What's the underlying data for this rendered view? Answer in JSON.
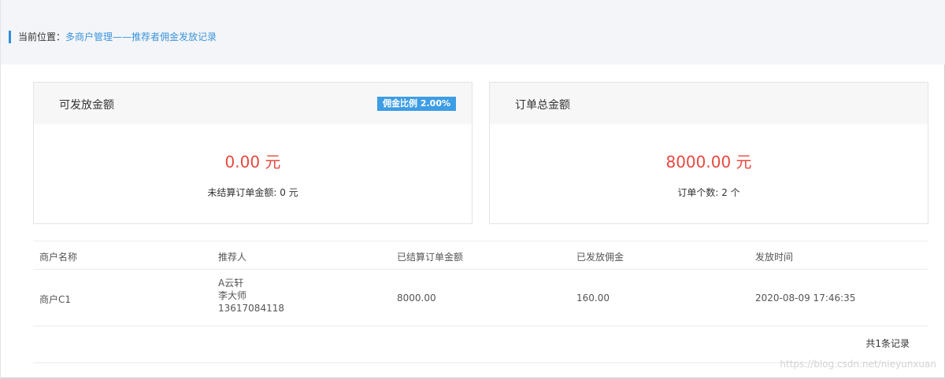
{
  "breadcrumb": {
    "label": "当前位置：",
    "path": "多商户管理——推荐者佣金发放记录"
  },
  "cards": {
    "left": {
      "title": "可发放金额",
      "badge": "佣金比例 2.00%",
      "value": "0.00 元",
      "sub": "未结算订单金额: 0 元"
    },
    "right": {
      "title": "订单总金额",
      "value": "8000.00 元",
      "sub": "订单个数: 2 个"
    }
  },
  "table": {
    "headers": [
      "商户名称",
      "推荐人",
      "已结算订单金额",
      "已发放佣金",
      "发放时间"
    ],
    "rows": [
      {
        "merchant": "商户C1",
        "referrer": [
          "A云轩",
          "李大师",
          "13617084118"
        ],
        "settled_amount": "8000.00",
        "commission": "160.00",
        "time": "2020-08-09 17:46:35"
      }
    ]
  },
  "footer": {
    "total": "共1条记录"
  },
  "watermark": "https://blog.csdn.net/nieyunxuan",
  "colors": {
    "accent": "#3c94dc",
    "value_red": "#e8483f",
    "badge_blue": "#3d9de5"
  }
}
